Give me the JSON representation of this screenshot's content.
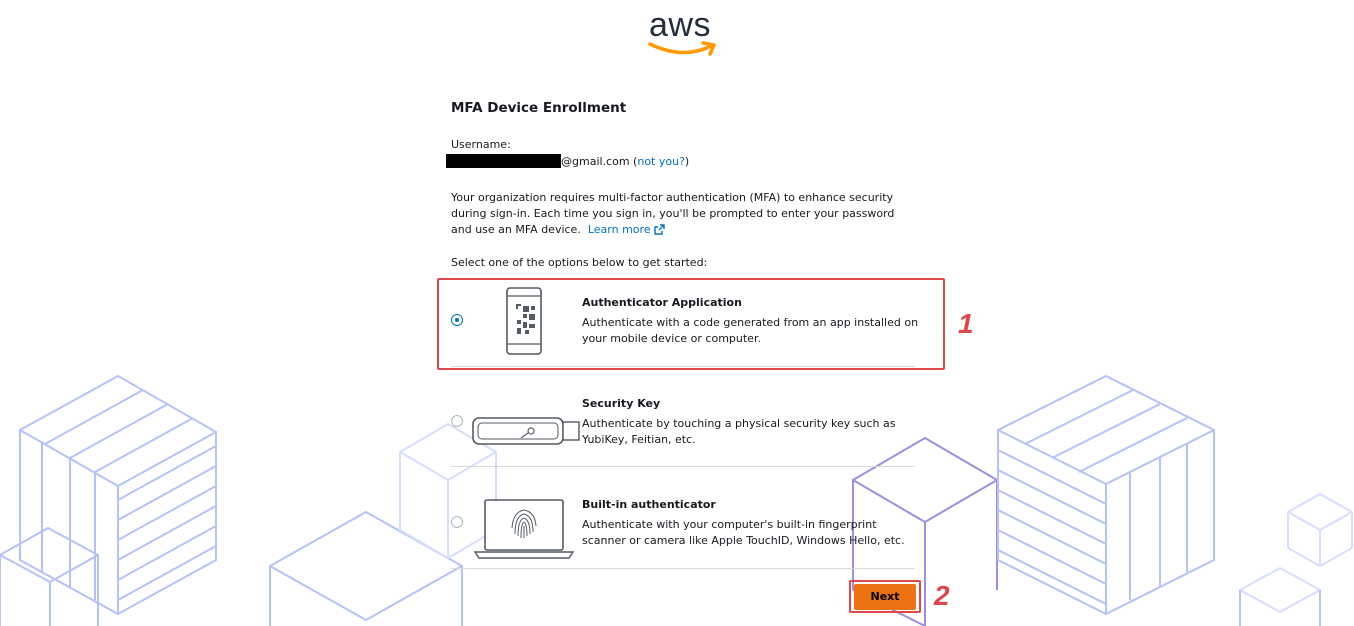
{
  "brand": {
    "logo_text": "aws",
    "smile_color": "#ff9900",
    "text_color": "#232f3e"
  },
  "page": {
    "title": "MFA Device Enrollment",
    "username_label": "Username:",
    "username_suffix": "@gmail.com",
    "open_paren": "(",
    "not_you_link": "not you?",
    "close_paren": ")",
    "description": "Your organization requires multi-factor authentication (MFA) to enhance security during sign-in. Each time you sign in, you'll be prompted to enter your password and use an MFA device.",
    "learn_more_link": "Learn more",
    "select_label": "Select one of the options below to get started:"
  },
  "options": [
    {
      "title": "Authenticator Application",
      "description": "Authenticate with a code generated from an app installed on your mobile device or computer.",
      "selected": true,
      "icon": "mobile-qr-icon"
    },
    {
      "title": "Security Key",
      "description": "Authenticate by touching a physical security key such as YubiKey, Feitian, etc.",
      "selected": false,
      "icon": "usb-key-icon"
    },
    {
      "title": "Built-in authenticator",
      "description": "Authenticate with your computer's built-in fingerprint scanner or camera like Apple TouchID, Windows Hello, etc.",
      "selected": false,
      "icon": "laptop-fingerprint-icon"
    }
  ],
  "actions": {
    "next_label": "Next"
  },
  "annotations": {
    "marker_1": "1",
    "marker_2": "2",
    "highlight_color": "#e0474c"
  },
  "colors": {
    "accent_link": "#0073bb",
    "primary_button": "#ec7211",
    "background_cubes": "#aebcf5"
  }
}
